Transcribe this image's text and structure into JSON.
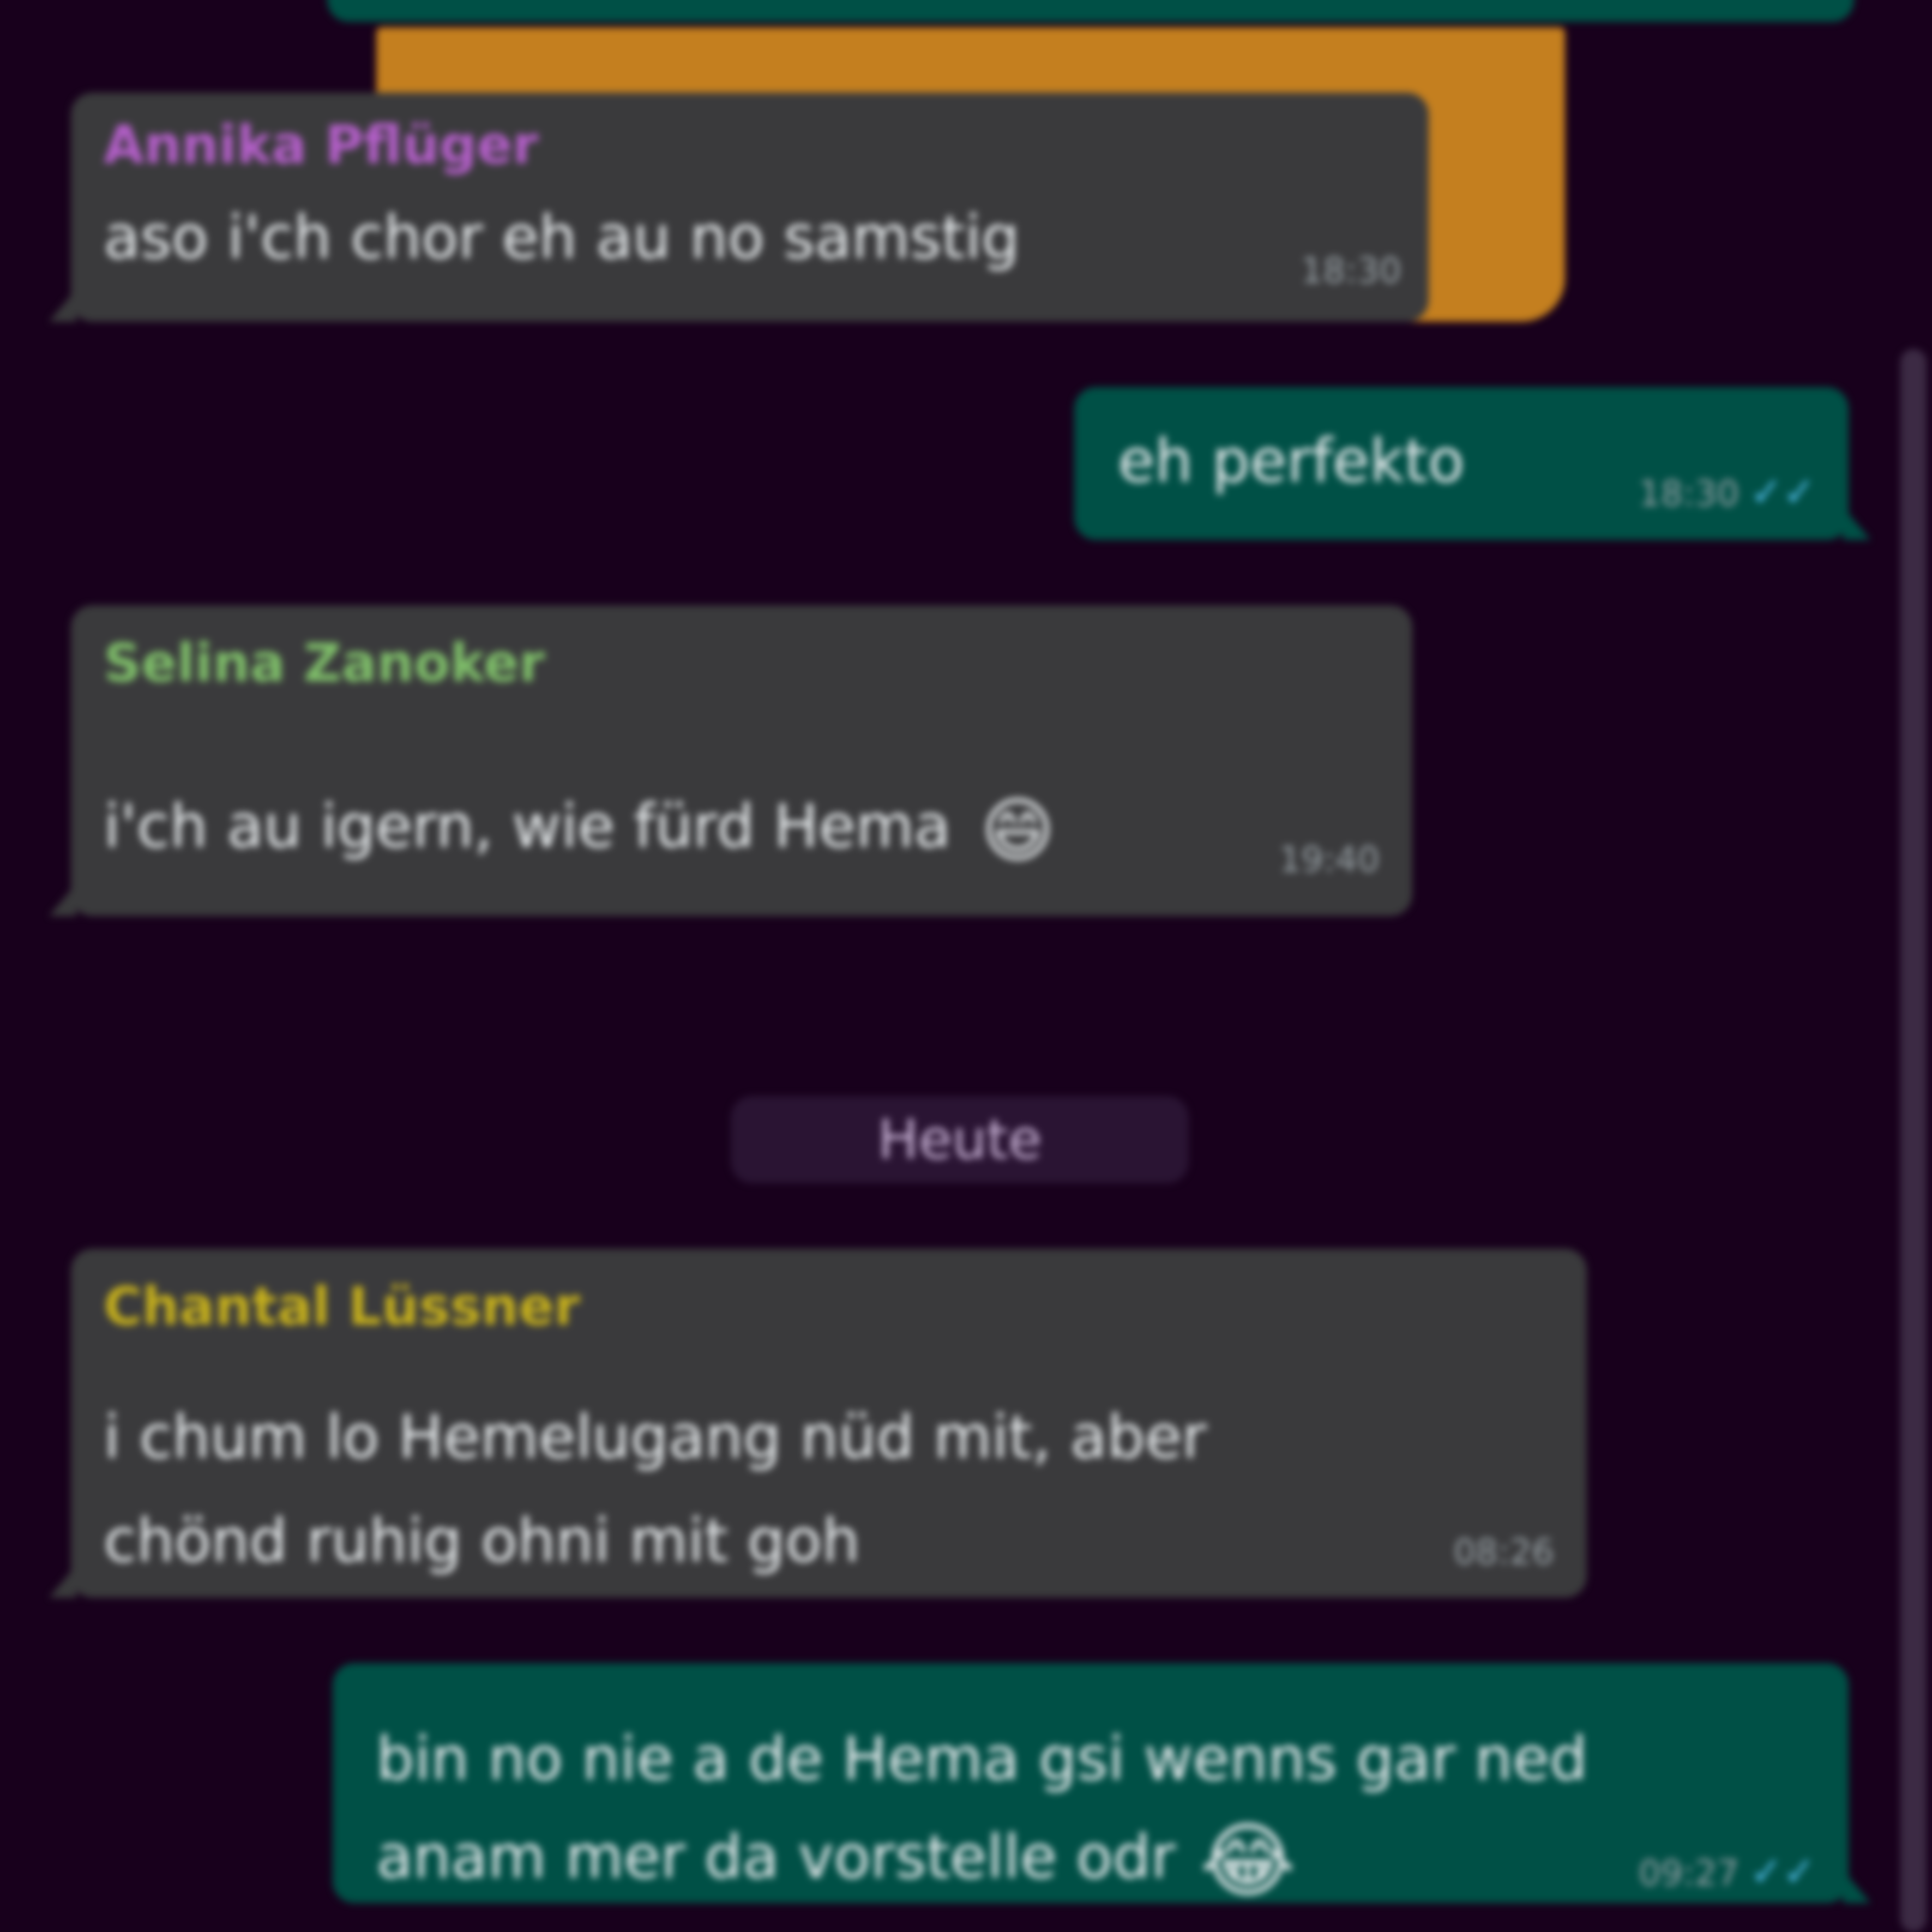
{
  "colors": {
    "background": "#18001c",
    "incoming_bubble": "#3a3a3c",
    "outgoing_bubble": "#005046",
    "sticker_orange": "#c47f1f"
  },
  "messages": [
    {
      "sender": "Annika Pflüger",
      "sender_color": "#b45fc9",
      "text": "aso i'ch chor eh au no samstig",
      "time": "18:30"
    },
    {
      "text": "eh perfekto",
      "time": "18:30",
      "status_icon": "double-check-icon"
    },
    {
      "sender": "Selina Zanoker",
      "sender_color": "#7fbf6a",
      "text": "i'ch au igern, wie fürd Hema",
      "emoji": "😄",
      "time": "19:40"
    },
    {
      "sender": "Chantal Lüssner",
      "sender_color": "#c6b01c",
      "text_line1": "i chum lo Hemelugang nüd mit, aber",
      "text_line2": "chönd ruhig ohni mit goh",
      "time": "08:26"
    },
    {
      "text_line1": "bin no nie a de Hema gsi wenns gar ned",
      "text_line2": "anam mer da vorstelle odr",
      "emoji": "😂",
      "time": "09:27",
      "status_icon": "double-check-icon"
    }
  ],
  "date_divider": "Heute"
}
